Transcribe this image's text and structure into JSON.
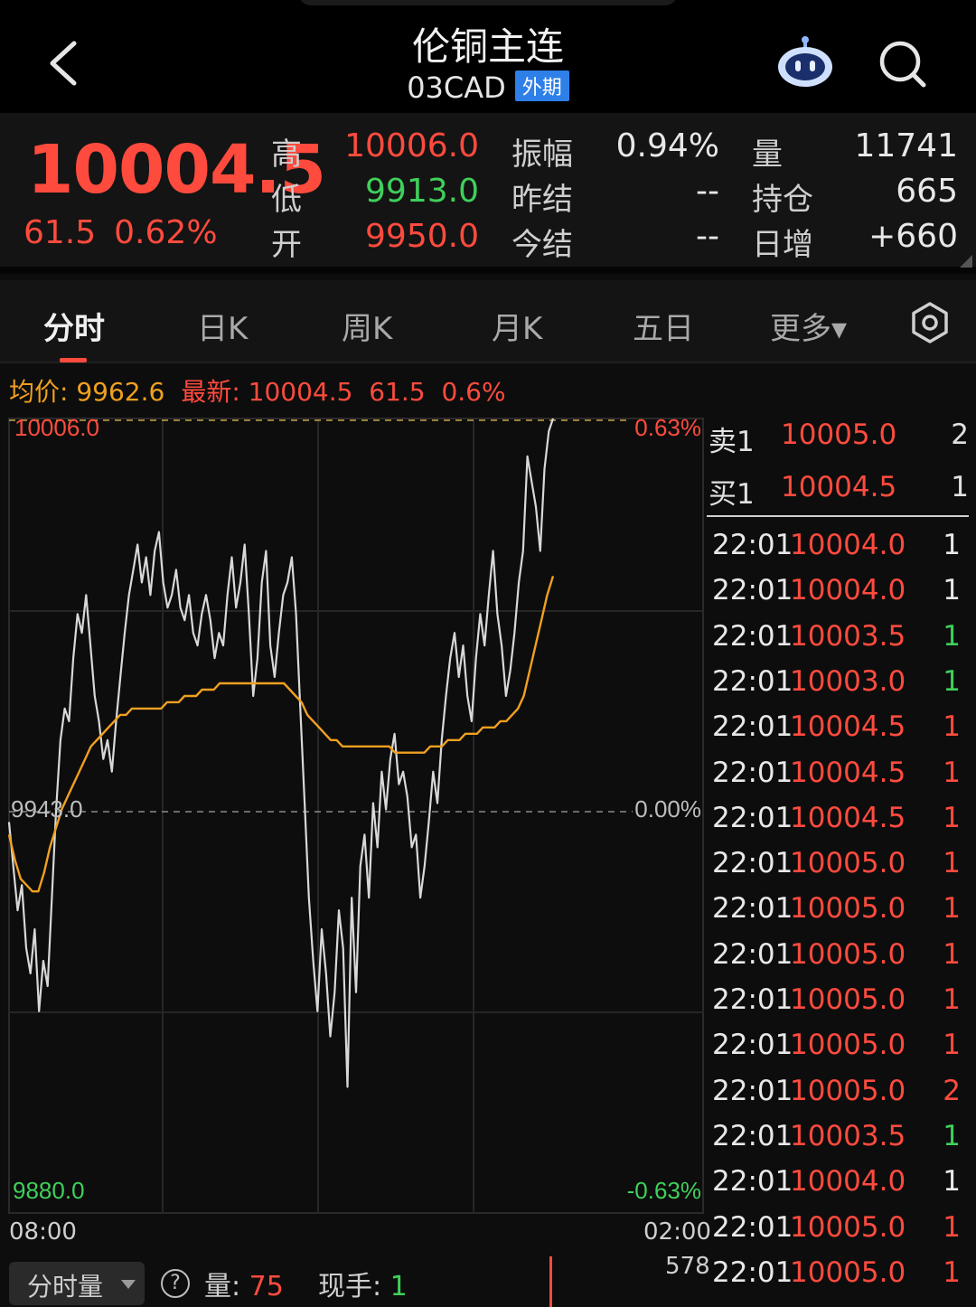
{
  "header": {
    "title": "伦铜主连",
    "code": "03CAD",
    "badge": "外期"
  },
  "quote": {
    "last": "10004.5",
    "change": "61.5",
    "change_pct": "0.62%",
    "high_label": "高",
    "high": "10006.0",
    "low_label": "低",
    "low": "9913.0",
    "open_label": "开",
    "open": "9950.0",
    "amp_label": "振幅",
    "amp": "0.94%",
    "prev_settle_label": "昨结",
    "prev_settle": "--",
    "settle_label": "今结",
    "settle": "--",
    "vol_label": "量",
    "vol": "11741",
    "oi_label": "持仓",
    "oi": "665",
    "oi_chg_label": "日增",
    "oi_chg": "+660"
  },
  "tabs": [
    "分时",
    "日K",
    "周K",
    "月K",
    "五日",
    "更多▾"
  ],
  "info": {
    "avg_label": "均价:",
    "avg": "9962.6",
    "latest_label": "最新:",
    "latest": "10004.5",
    "latest_chg": "61.5",
    "latest_pct": "0.6%"
  },
  "chart_data": {
    "type": "line",
    "y_labels": {
      "top": "10006.0",
      "mid": "9943.0",
      "bottom": "9880.0"
    },
    "pct_labels": {
      "top": "0.63%",
      "mid": "0.00%",
      "bottom": "-0.63%"
    },
    "x_labels": {
      "start": "08:00",
      "end": "02:00"
    },
    "ylim": [
      9880.0,
      10006.0
    ],
    "series": [
      {
        "values": [
          9942,
          9935,
          9928,
          9932,
          9922,
          9918,
          9925,
          9912,
          9920,
          9916,
          9930,
          9944,
          9955,
          9960,
          9958,
          9968,
          9975,
          9972,
          9978,
          9970,
          9962,
          9958,
          9952,
          9955,
          9950,
          9958,
          9965,
          9972,
          9978,
          9982,
          9986,
          9980,
          9984,
          9978,
          9985,
          9988,
          9980,
          9976,
          9978,
          9982,
          9976,
          9974,
          9978,
          9972,
          9970,
          9975,
          9978,
          9974,
          9968,
          9972,
          9970,
          9978,
          9984,
          9976,
          9980,
          9986,
          9975,
          9962,
          9968,
          9980,
          9985,
          9970,
          9965,
          9972,
          9978,
          9980,
          9984,
          9975,
          9960,
          9945,
          9930,
          9920,
          9912,
          9925,
          9918,
          9908,
          9915,
          9928,
          9922,
          9900,
          9930,
          9915,
          9935,
          9940,
          9930,
          9945,
          9938,
          9950,
          9944,
          9952,
          9956,
          9948,
          9950,
          9946,
          9938,
          9940,
          9930,
          9935,
          9942,
          9950,
          9945,
          9955,
          9962,
          9968,
          9972,
          9965,
          9970,
          9962,
          9958,
          9968,
          9975,
          9970,
          9978,
          9985,
          9975,
          9970,
          9962,
          9966,
          9972,
          9980,
          9985,
          10000,
          9996,
          9992,
          9985,
          9998,
          10004,
          10006
        ],
        "color": "#d8d8d8"
      },
      {
        "values": [
          9940,
          9936,
          9933,
          9932,
          9931,
          9931,
          9934,
          9938,
          9941,
          9944,
          9946,
          9948,
          9950,
          9952,
          9954,
          9955,
          9956,
          9957,
          9958,
          9959,
          9959,
          9960,
          9960,
          9960,
          9960,
          9960,
          9960,
          9961,
          9961,
          9961,
          9962,
          9962,
          9962,
          9963,
          9963,
          9963,
          9964,
          9964,
          9964,
          9964,
          9964,
          9964,
          9964,
          9964,
          9964,
          9964,
          9964,
          9964,
          9963,
          9962,
          9961,
          9959,
          9958,
          9957,
          9956,
          9955,
          9955,
          9954,
          9954,
          9954,
          9954,
          9954,
          9954,
          9954,
          9954,
          9954,
          9953,
          9953,
          9953,
          9953,
          9953,
          9953,
          9954,
          9954,
          9954,
          9955,
          9955,
          9955,
          9956,
          9956,
          9956,
          9957,
          9957,
          9957,
          9958,
          9958,
          9959,
          9960,
          9962,
          9966,
          9970,
          9974,
          9978,
          9981
        ],
        "color": "#f0a020"
      }
    ]
  },
  "book": [
    {
      "label": "卖1",
      "price": "10005.0",
      "qty": "2"
    },
    {
      "label": "买1",
      "price": "10004.5",
      "qty": "1"
    }
  ],
  "ticks": [
    {
      "t": "22:01",
      "p": "10004.0",
      "v": "1",
      "c": "white"
    },
    {
      "t": "22:01",
      "p": "10004.0",
      "v": "1",
      "c": "white"
    },
    {
      "t": "22:01",
      "p": "10003.5",
      "v": "1",
      "c": "green"
    },
    {
      "t": "22:01",
      "p": "10003.0",
      "v": "1",
      "c": "green"
    },
    {
      "t": "22:01",
      "p": "10004.5",
      "v": "1",
      "c": "red"
    },
    {
      "t": "22:01",
      "p": "10004.5",
      "v": "1",
      "c": "red"
    },
    {
      "t": "22:01",
      "p": "10004.5",
      "v": "1",
      "c": "red"
    },
    {
      "t": "22:01",
      "p": "10005.0",
      "v": "1",
      "c": "red"
    },
    {
      "t": "22:01",
      "p": "10005.0",
      "v": "1",
      "c": "red"
    },
    {
      "t": "22:01",
      "p": "10005.0",
      "v": "1",
      "c": "red"
    },
    {
      "t": "22:01",
      "p": "10005.0",
      "v": "1",
      "c": "red"
    },
    {
      "t": "22:01",
      "p": "10005.0",
      "v": "1",
      "c": "red"
    },
    {
      "t": "22:01",
      "p": "10005.0",
      "v": "2",
      "c": "red"
    },
    {
      "t": "22:01",
      "p": "10003.5",
      "v": "1",
      "c": "green"
    },
    {
      "t": "22:01",
      "p": "10004.0",
      "v": "1",
      "c": "white"
    },
    {
      "t": "22:01",
      "p": "10005.0",
      "v": "1",
      "c": "red"
    },
    {
      "t": "22:01",
      "p": "10005.0",
      "v": "1",
      "c": "red"
    }
  ],
  "bottom": {
    "select": "分时量",
    "help": "?",
    "vol_label": "量:",
    "vol": "75",
    "hand_label": "现手:",
    "hand": "1",
    "vol_max": "578"
  }
}
